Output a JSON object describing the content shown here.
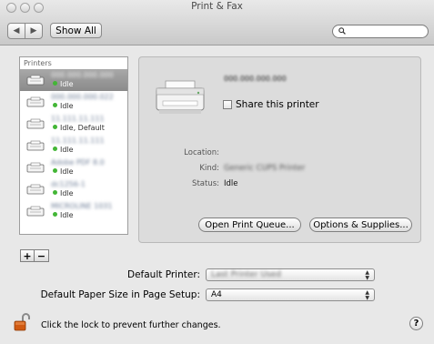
{
  "window": {
    "title": "Print & Fax"
  },
  "toolbar": {
    "back_icon": "back-arrow-icon",
    "forward_icon": "forward-arrow-icon",
    "back_glyph": "◀",
    "forward_glyph": "▶",
    "show_all_label": "Show All",
    "search_value": "",
    "search_icon": "magnifier-icon"
  },
  "printer_list": {
    "header": "Printers",
    "items": [
      {
        "name": "000.000.000.000",
        "status": "Idle",
        "selected": true
      },
      {
        "name": "000.000.000.022",
        "status": "Idle",
        "selected": false
      },
      {
        "name": "11.111.11.111",
        "status": "Idle, Default",
        "selected": false
      },
      {
        "name": "11.111.11.111",
        "status": "Idle",
        "selected": false
      },
      {
        "name": "Adobe PDF 8.0",
        "status": "Idle",
        "selected": false
      },
      {
        "name": "dc1256-1",
        "status": "Idle",
        "selected": false
      },
      {
        "name": "MICROLINE 1031",
        "status": "Idle",
        "selected": false
      }
    ],
    "add_label": "+",
    "remove_label": "−"
  },
  "detail": {
    "printer_name": "000.000.000.000",
    "share_label": "Share this printer",
    "location_label": "Location:",
    "location_value": "",
    "kind_label": "Kind:",
    "kind_value": "Generic CUPS Printer",
    "status_label": "Status:",
    "status_value": "Idle",
    "open_queue_label": "Open Print Queue...",
    "options_label": "Options & Supplies..."
  },
  "settings": {
    "default_printer_label": "Default Printer:",
    "default_printer_value": "Last Printer Used",
    "paper_size_label": "Default Paper Size in Page Setup:",
    "paper_size_value": "A4"
  },
  "footer": {
    "lock_text": "Click the lock to prevent further changes.",
    "lock_icon": "lock-open-icon",
    "help_label": "?"
  },
  "colors": {
    "status_dot": "#43b636",
    "selection": "#9a9a9a",
    "panel": "#dcdcdc",
    "lock": "#d05a12"
  }
}
